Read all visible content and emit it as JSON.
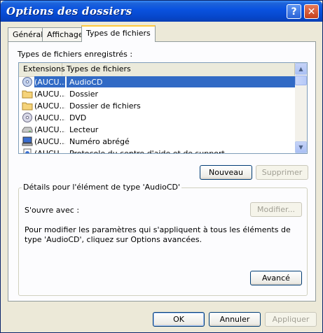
{
  "window": {
    "title": "Options des dossiers",
    "help_glyph": "?",
    "close_glyph": "✕"
  },
  "tabs": [
    {
      "label": "Général"
    },
    {
      "label": "Affichage"
    },
    {
      "label": "Types de fichiers",
      "active": true
    }
  ],
  "registered": {
    "label": "Types de fichiers enregistrés :",
    "columns": [
      "Extensions",
      "Types de fichiers"
    ],
    "rows": [
      {
        "ext": "(AUCU...",
        "type": "AudioCD",
        "icon": "audio-cd-icon",
        "selected": true
      },
      {
        "ext": "(AUCU...",
        "type": "Dossier",
        "icon": "folder-icon"
      },
      {
        "ext": "(AUCU...",
        "type": "Dossier de fichiers",
        "icon": "folder-icon"
      },
      {
        "ext": "(AUCU...",
        "type": "DVD",
        "icon": "dvd-icon"
      },
      {
        "ext": "(AUCU...",
        "type": "Lecteur",
        "icon": "drive-icon"
      },
      {
        "ext": "(AUCU...",
        "type": "Numéro abrégé",
        "icon": "computer-icon"
      },
      {
        "ext": "(AUCU...",
        "type": "Protocole du centre d'aide et de support",
        "icon": "help-file-icon"
      }
    ]
  },
  "buttons": {
    "new": "Nouveau",
    "delete": "Supprimer",
    "modify": "Modifier...",
    "advanced": "Avancé",
    "ok": "OK",
    "cancel": "Annuler",
    "apply": "Appliquer"
  },
  "details": {
    "title": "Détails pour l'élément de type 'AudioCD'",
    "opens_with": "S'ouvre avec :",
    "description": "Pour modifier les paramètres qui s'appliquent à tous les éléments de type 'AudioCD', cliquez sur Options avancées."
  },
  "colors": {
    "title_bar": "#0a53e0",
    "selection": "#316ac5",
    "dialog_bg": "#ece9d8"
  }
}
